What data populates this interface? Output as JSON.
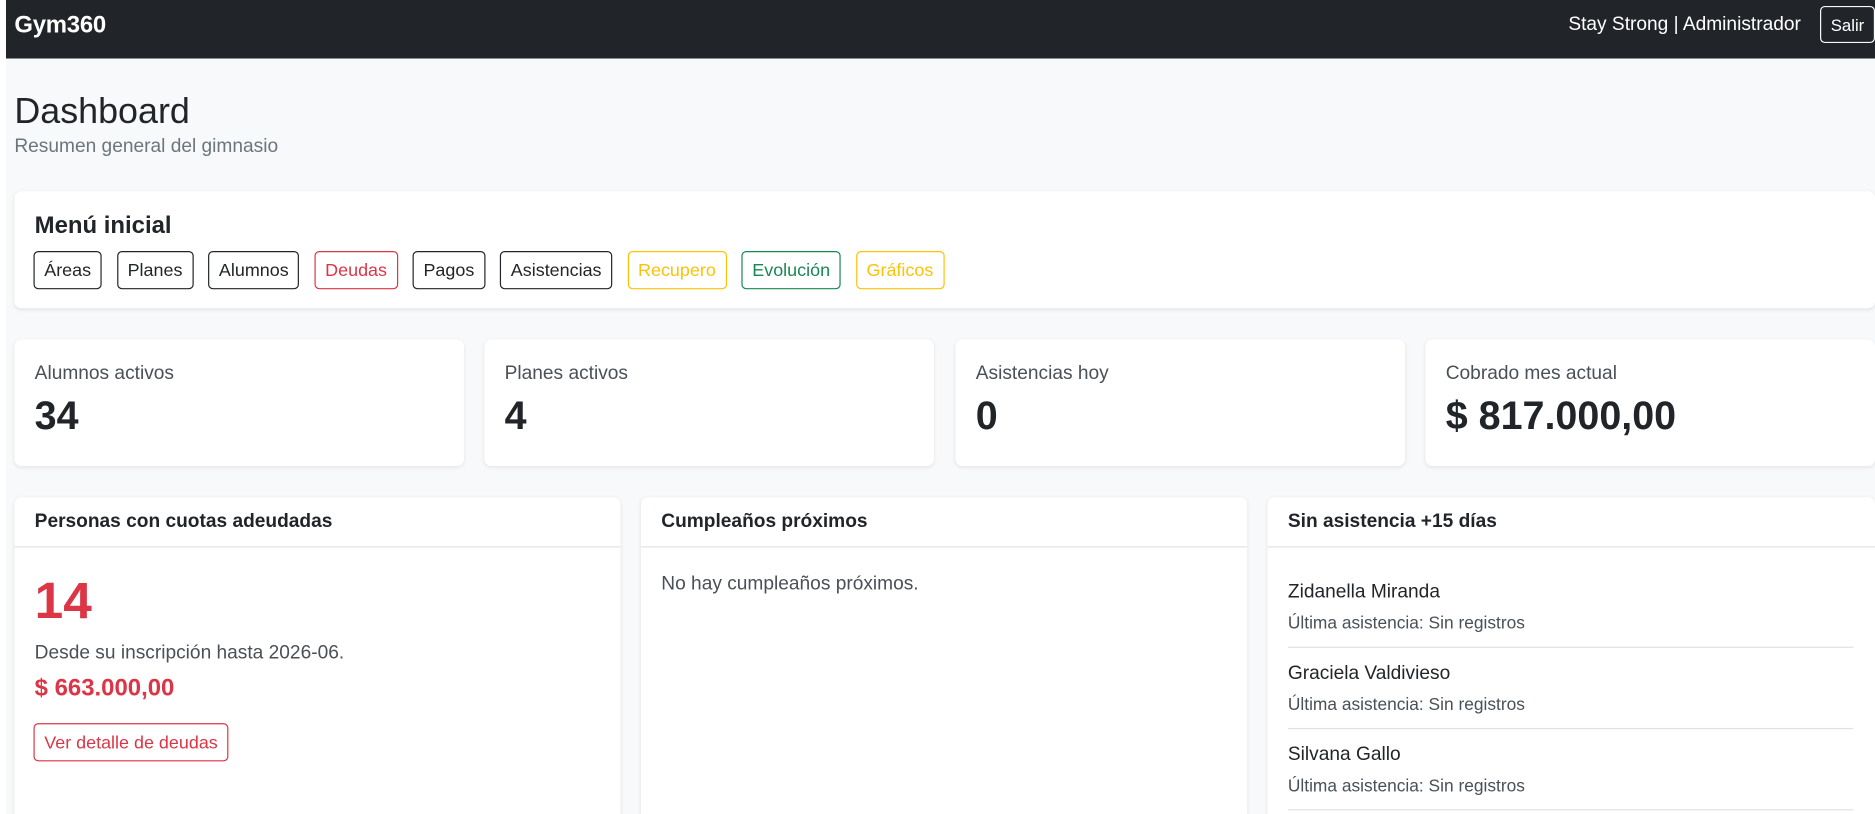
{
  "navbar": {
    "brand": "Gym360",
    "user": "Stay Strong | Administrador",
    "logout_label": "Salir"
  },
  "header": {
    "title": "Dashboard",
    "subtitle": "Resumen general del gimnasio"
  },
  "menu": {
    "title": "Menú inicial",
    "buttons": [
      {
        "label": "Áreas",
        "style": "dark"
      },
      {
        "label": "Planes",
        "style": "dark"
      },
      {
        "label": "Alumnos",
        "style": "dark"
      },
      {
        "label": "Deudas",
        "style": "danger"
      },
      {
        "label": "Pagos",
        "style": "dark"
      },
      {
        "label": "Asistencias",
        "style": "dark"
      },
      {
        "label": "Recupero",
        "style": "warning"
      },
      {
        "label": "Evolución",
        "style": "success"
      },
      {
        "label": "Gráficos",
        "style": "warning"
      }
    ]
  },
  "stats": [
    {
      "label": "Alumnos activos",
      "value": "34"
    },
    {
      "label": "Planes activos",
      "value": "4"
    },
    {
      "label": "Asistencias hoy",
      "value": "0"
    },
    {
      "label": "Cobrado mes actual",
      "value": "$ 817.000,00"
    }
  ],
  "debts": {
    "title": "Personas con cuotas adeudadas",
    "count": "14",
    "description": "Desde su inscripción hasta 2026-06.",
    "amount": "$ 663.000,00",
    "button_label": "Ver detalle de deudas"
  },
  "birthdays": {
    "title": "Cumpleaños próximos",
    "empty_text": "No hay cumpleaños próximos."
  },
  "absent": {
    "title": "Sin asistencia +15 días",
    "items": [
      {
        "name": "Zidanella Miranda",
        "last": "Última asistencia: Sin registros"
      },
      {
        "name": "Graciela Valdivieso",
        "last": "Última asistencia: Sin registros"
      },
      {
        "name": "Silvana Gallo",
        "last": "Última asistencia: Sin registros"
      }
    ]
  },
  "colors": {
    "navbar_bg": "#212529",
    "page_bg": "#f8f9fa",
    "danger": "#dc3545",
    "warning": "#ffc107",
    "success": "#198754"
  }
}
